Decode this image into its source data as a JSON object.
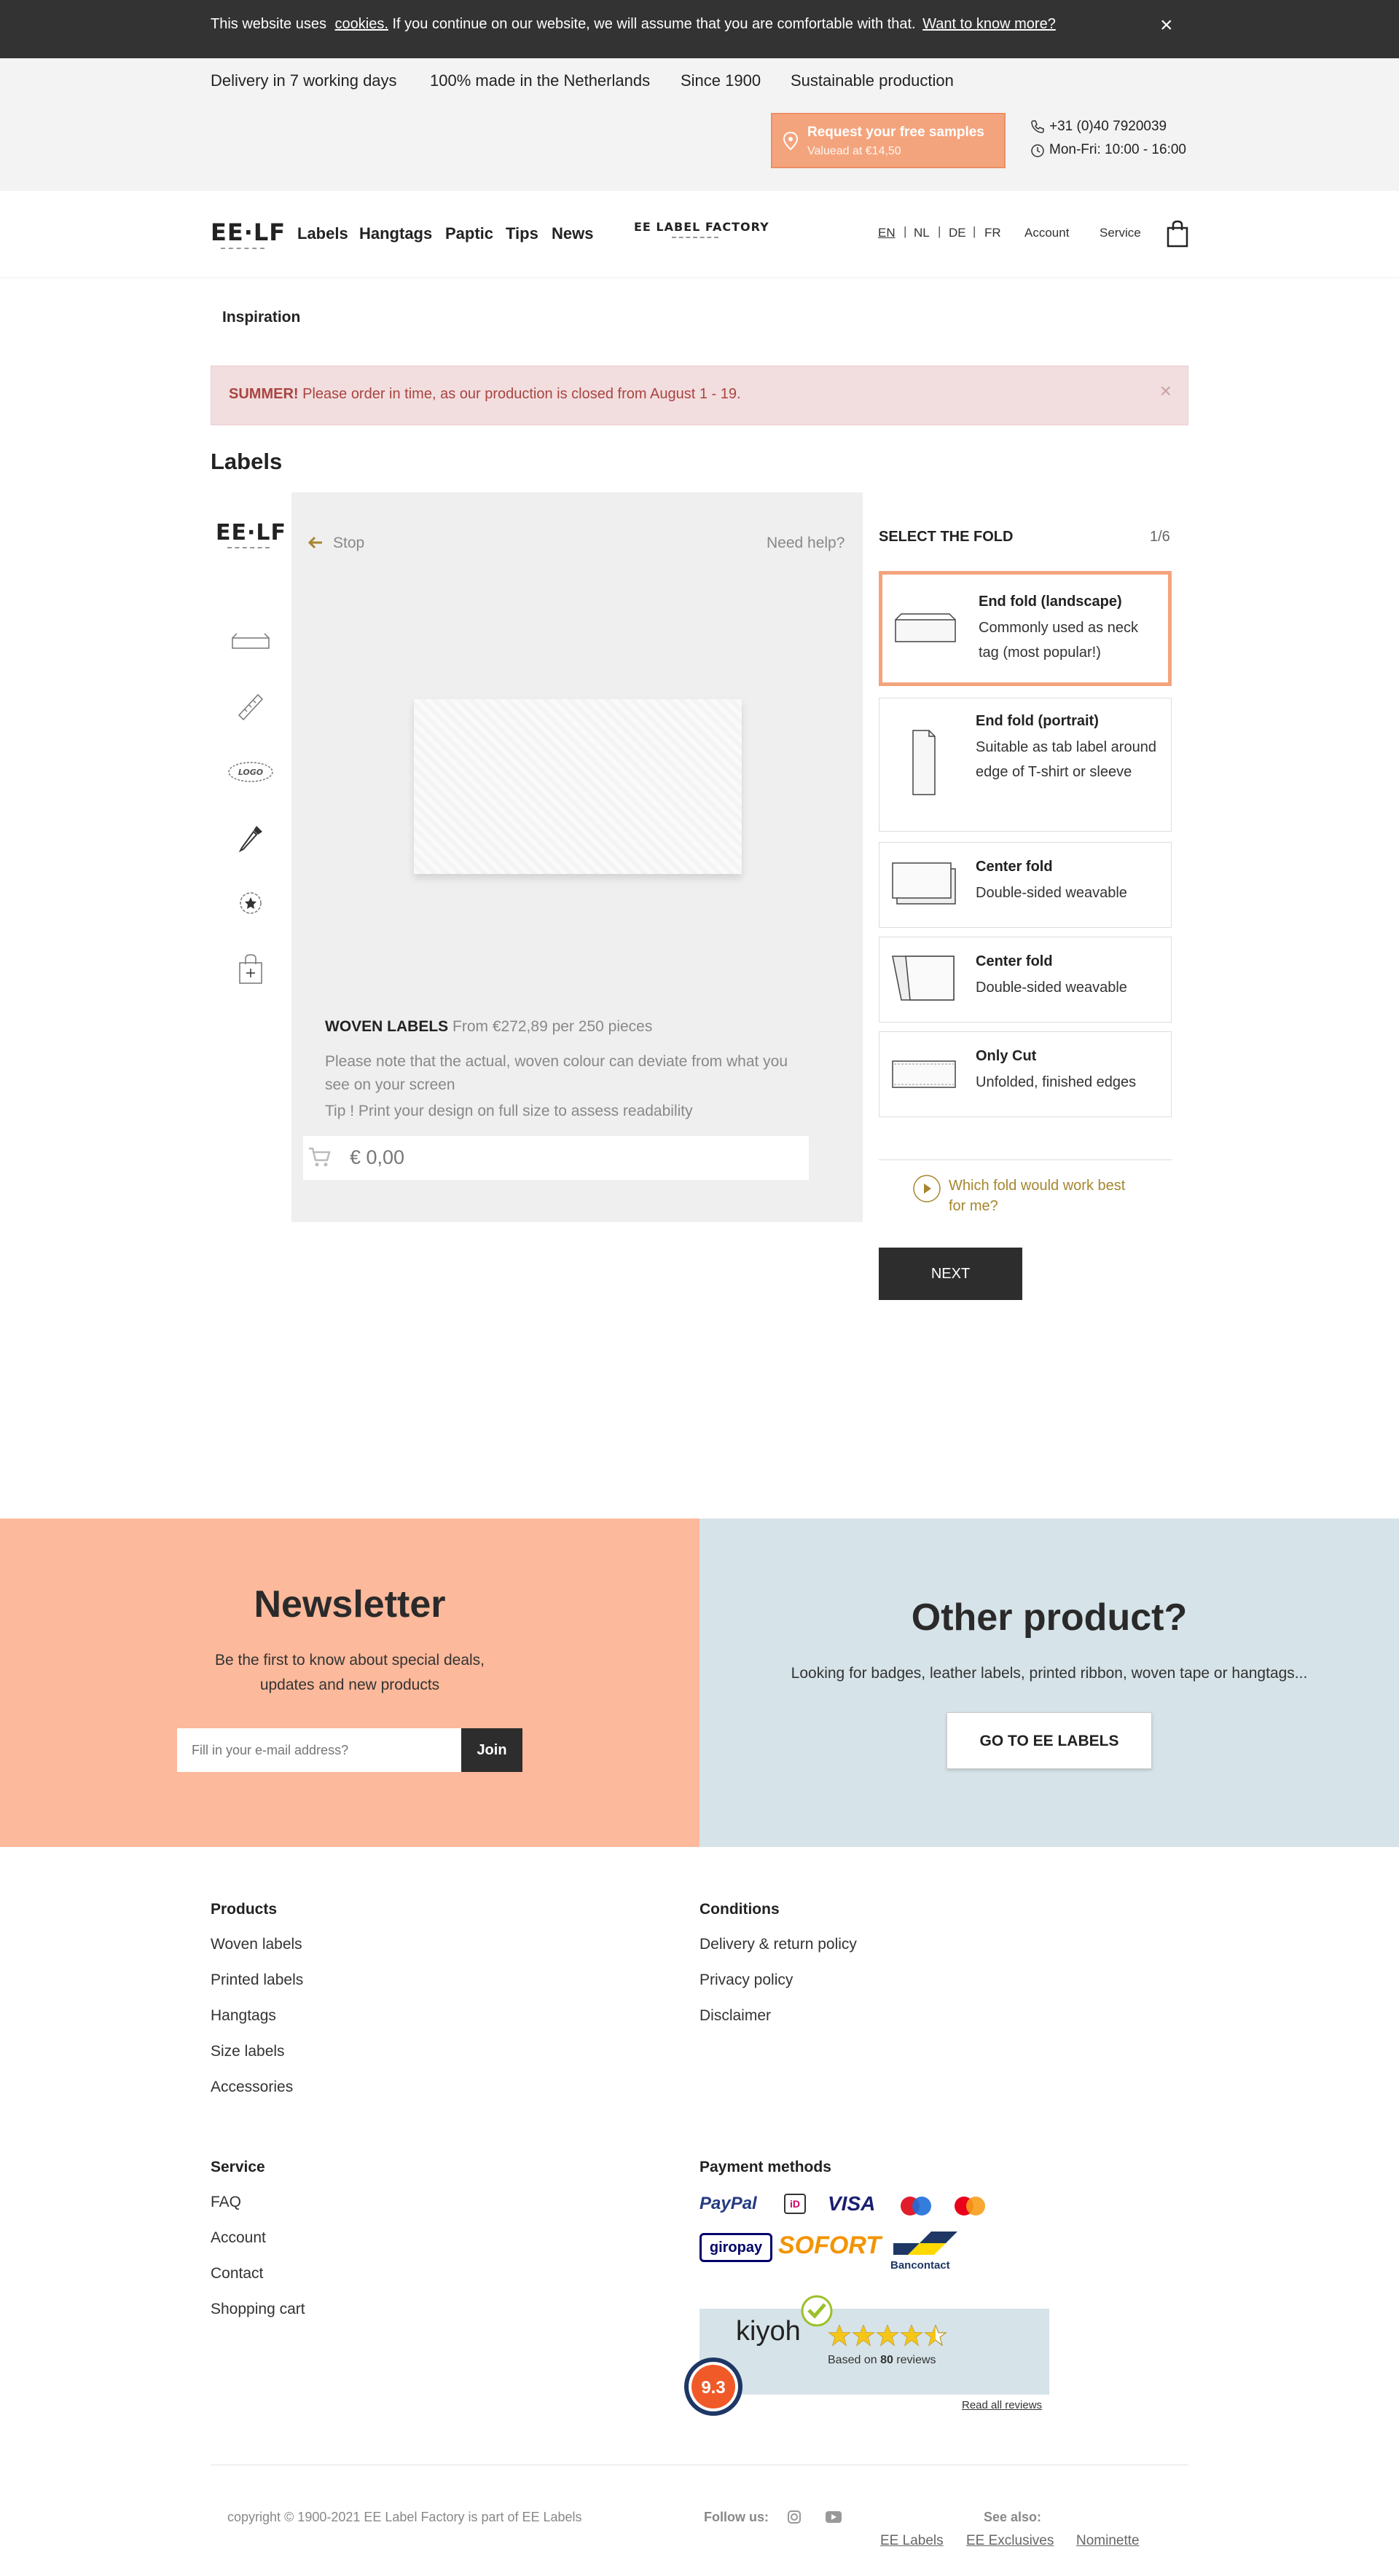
{
  "cookie": {
    "pre": "This website uses",
    "link": "cookies.",
    "mid": " If you continue on our website, we will assume that you are comfortable with that.",
    "more": "Want to know more?",
    "close": "×"
  },
  "usps": [
    "Delivery in 7 working days",
    "100% made in the Netherlands",
    "Since 1900",
    "Sustainable production"
  ],
  "samples": {
    "title": "Request your free samples",
    "sub": "Valuead at €14,50"
  },
  "contact": {
    "phone": "+31 (0)40 7920039",
    "hours": "Mon-Fri: 10:00 - 16:00"
  },
  "nav": {
    "logo": "EE·LF",
    "links": [
      "Labels",
      "Hangtags",
      "Paptic",
      "Tips",
      "News"
    ],
    "center_logo": "EE LABEL FACTORY",
    "langs": [
      "EN",
      "NL",
      "DE",
      "FR"
    ],
    "account": "Account",
    "service": "Service"
  },
  "subnav": {
    "inspiration": "Inspiration"
  },
  "alert": {
    "strong": "SUMMER!",
    "text": " Please order in time, as our production is closed from August 1 - 19.",
    "close": "×"
  },
  "page_title": "Labels",
  "configurator": {
    "logo": "EE·LF",
    "back": "Stop",
    "help": "Need help?",
    "product_name": "WOVEN LABELS",
    "product_price": " From €272,89 per 250 pieces",
    "note1": "Please note that the actual, woven colour can deviate from what you",
    "note2": "see on your screen",
    "tip": "Tip ! Print your design on full size to assess readability",
    "price": "€ 0,00",
    "logo_icon_text": "LOGO"
  },
  "step": {
    "title": "SELECT THE FOLD",
    "counter": "1/6",
    "options": [
      {
        "title": "End fold (landscape)",
        "desc": "Commonly used as neck tag (most popular!)",
        "selected": true
      },
      {
        "title": "End fold (portrait)",
        "desc": "Suitable as tab label around edge of T-shirt or sleeve",
        "selected": false
      },
      {
        "title": "Center fold",
        "desc": "Double-sided weavable",
        "selected": false
      },
      {
        "title": "Center fold",
        "desc": "Double-sided weavable",
        "selected": false
      },
      {
        "title": "Only Cut",
        "desc": "Unfolded, finished edges",
        "selected": false
      }
    ],
    "help_link": "Which fold would work best for me?",
    "next": "NEXT"
  },
  "newsletter": {
    "title": "Newsletter",
    "sub1": "Be the first to know about special deals,",
    "sub2": "updates and new products",
    "placeholder": "Fill in your e-mail address?",
    "join": "Join"
  },
  "other": {
    "title": "Other product?",
    "sub": "Looking for badges, leather labels, printed ribbon, woven tape or hangtags...",
    "button": "GO TO EE LABELS"
  },
  "footer": {
    "products": {
      "title": "Products",
      "items": [
        "Woven labels",
        "Printed labels",
        "Hangtags",
        "Size labels",
        "Accessories"
      ]
    },
    "conditions": {
      "title": "Conditions",
      "items": [
        "Delivery & return policy",
        "Privacy policy",
        "Disclaimer"
      ]
    },
    "service": {
      "title": "Service",
      "items": [
        "FAQ",
        "Account",
        "Contact",
        "Shopping cart"
      ]
    },
    "payment": {
      "title": "Payment methods",
      "methods": [
        "PayPal",
        "iD",
        "VISA",
        "Maestro",
        "Mastercard",
        "giropay",
        "SOFORT",
        "Bancontact"
      ]
    },
    "kiyoh": {
      "brand": "kiyoh",
      "score": "9.3",
      "based_pre": "Based on ",
      "count": "80",
      "based_post": " reviews",
      "read": "Read all reviews",
      "rating": 4.5
    },
    "copyright": "copyright © 1900-2021 EE Label Factory is part of EE Labels",
    "follow": "Follow us:",
    "see_also": "See also:",
    "see_links": [
      "EE Labels",
      "EE Exclusives",
      "Nominette"
    ]
  },
  "colors": {
    "accent": "#f4a47d",
    "dark": "#2d2d2d",
    "newsletter_bg": "#fcb99b",
    "other_bg": "#d6e3e8",
    "gold": "#a6862f"
  }
}
